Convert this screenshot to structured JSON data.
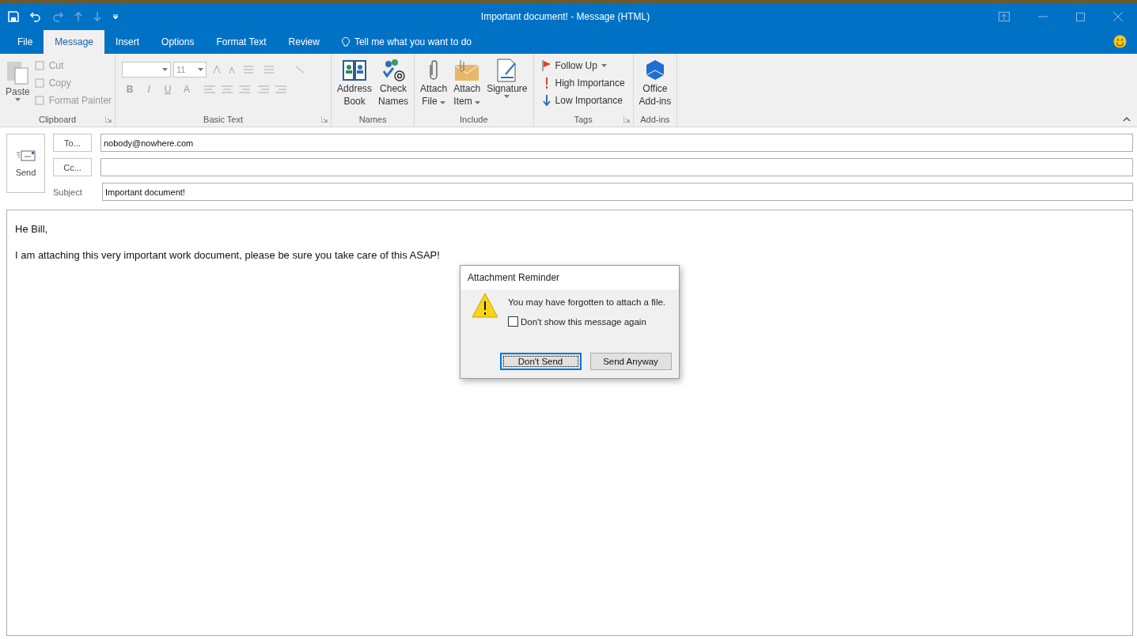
{
  "window": {
    "title": "Important document! - Message (HTML)"
  },
  "tabs": [
    {
      "label": "File",
      "selected": false
    },
    {
      "label": "Message",
      "selected": true
    },
    {
      "label": "Insert",
      "selected": false
    },
    {
      "label": "Options",
      "selected": false
    },
    {
      "label": "Format Text",
      "selected": false
    },
    {
      "label": "Review",
      "selected": false
    }
  ],
  "tell_me": "Tell me what you want to do",
  "ribbon": {
    "groups": [
      {
        "kind": "clipboard",
        "label": "Clipboard",
        "launcher": true,
        "items": [
          {
            "label": "Paste",
            "disabled": true
          },
          {
            "label": "Cut",
            "disabled": true
          },
          {
            "label": "Copy",
            "disabled": true
          },
          {
            "label": "Format Painter",
            "disabled": true
          }
        ]
      },
      {
        "kind": "basic_text",
        "label": "Basic Text",
        "launcher": true,
        "font_size": "11",
        "items": [
          {
            "label": "B",
            "disabled": true
          },
          {
            "label": "I",
            "disabled": true
          },
          {
            "label": "U",
            "disabled": true
          },
          {
            "label": "A",
            "disabled": true
          }
        ]
      },
      {
        "kind": "large",
        "label": "Names",
        "launcher": false,
        "items": [
          {
            "lines": [
              "Address",
              "Book"
            ],
            "dropdown": false
          },
          {
            "lines": [
              "Check",
              "Names"
            ],
            "dropdown": false
          }
        ]
      },
      {
        "kind": "large",
        "label": "Include",
        "launcher": false,
        "items": [
          {
            "lines": [
              "Attach",
              "File"
            ],
            "dropdown": true
          },
          {
            "lines": [
              "Attach",
              "Item"
            ],
            "dropdown": true
          },
          {
            "lines": [
              "Signature"
            ],
            "dropdown": true
          }
        ]
      },
      {
        "kind": "tags",
        "label": "Tags",
        "launcher": true,
        "items": [
          {
            "label": "Follow Up",
            "dropdown": true
          },
          {
            "label": "High Importance",
            "dropdown": false
          },
          {
            "label": "Low Importance",
            "dropdown": false
          }
        ]
      },
      {
        "kind": "large",
        "label": "Add-ins",
        "launcher": false,
        "items": [
          {
            "lines": [
              "Office",
              "Add-ins"
            ],
            "dropdown": false
          }
        ]
      }
    ]
  },
  "compose": {
    "send": "Send",
    "fields": [
      {
        "kind": "button",
        "label": "To...",
        "value": "nobody@nowhere.com"
      },
      {
        "kind": "button",
        "label": "Cc..."
      },
      {
        "kind": "label",
        "label": "Subject",
        "value": "Important document!"
      }
    ]
  },
  "body": [
    "He Bill,",
    "I am attaching this very important work document, please be sure you take care of this ASAP!"
  ],
  "dialog": {
    "title": "Attachment Reminder",
    "message": "You may have forgotten to attach a file.",
    "checkbox": {
      "label": "Don't show this message again",
      "checked": false
    },
    "buttons": [
      {
        "label": "Don't Send",
        "default": true
      },
      {
        "label": "Send Anyway",
        "default": false
      }
    ]
  }
}
